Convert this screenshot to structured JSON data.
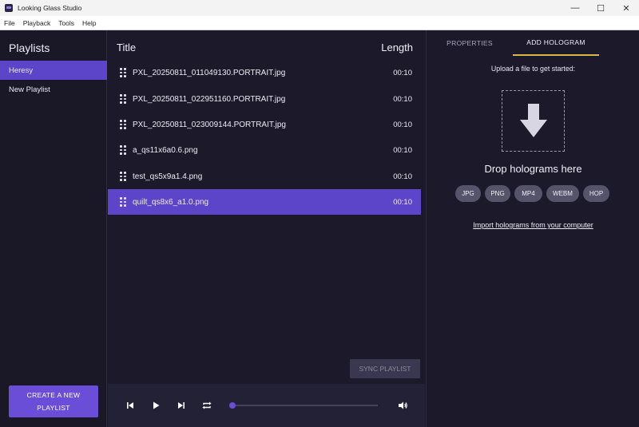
{
  "window": {
    "title": "Looking Glass Studio",
    "controls": {
      "minimize": "—",
      "maximize": "☐",
      "close": "✕"
    }
  },
  "menu": [
    "File",
    "Playback",
    "Tools",
    "Help"
  ],
  "sidebar": {
    "title": "Playlists",
    "playlists": [
      {
        "label": "Heresy",
        "active": true
      },
      {
        "label": "New Playlist",
        "active": false
      }
    ],
    "create_button": {
      "line1": "CREATE A NEW",
      "line2": "PLAYLIST"
    }
  },
  "list": {
    "header_title": "Title",
    "header_length": "Length",
    "files": [
      {
        "name": "PXL_20250811_011049130.PORTRAIT.jpg",
        "length": "00:10"
      },
      {
        "name": "PXL_20250811_022951160.PORTRAIT.jpg",
        "length": "00:10"
      },
      {
        "name": "PXL_20250811_023009144.PORTRAIT.jpg",
        "length": "00:10"
      },
      {
        "name": "a_qs11x6a0.6.png",
        "length": "00:10"
      },
      {
        "name": "test_qs5x9a1.4.png",
        "length": "00:10"
      },
      {
        "name": "quilt_qs8x6_a1.0.png",
        "length": "00:10"
      }
    ],
    "selected_index": 5,
    "sync_button": "SYNC PLAYLIST"
  },
  "player": {
    "icons": [
      "skip-previous-icon",
      "play-icon",
      "skip-next-icon",
      "repeat-icon",
      "volume-icon"
    ],
    "progress": 0.0
  },
  "right_panel": {
    "tabs": [
      {
        "label": "PROPERTIES",
        "active": false
      },
      {
        "label": "ADD HOLOGRAM",
        "active": true
      }
    ],
    "upload_text": "Upload a file to get started:",
    "drop_text": "Drop holograms here",
    "formats": [
      "JPG",
      "PNG",
      "MP4",
      "WEBM",
      "HOP"
    ],
    "import_link": "Import holograms from your computer",
    "tab_accent_color": "#d9b64a"
  },
  "colors": {
    "accent": "#6a4ed8",
    "selected_row": "#5d45c9",
    "background": "#1c1a2a"
  }
}
